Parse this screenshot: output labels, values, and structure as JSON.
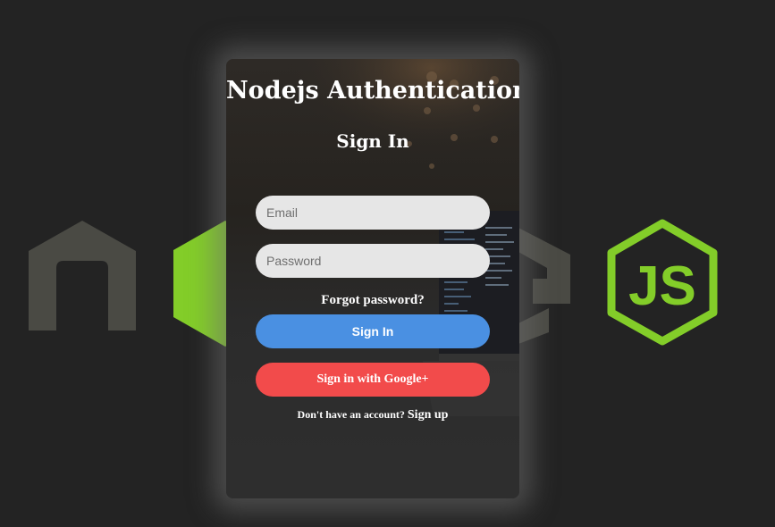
{
  "colors": {
    "page_background": "#232323",
    "node_green": "#83cd29",
    "node_grey": "#4a4a44",
    "field_background": "#e6e6e6",
    "signin_button": "#4a90e2",
    "google_button": "#f24b4b",
    "text": "#ffffff"
  },
  "background": {
    "logo_icon": "nodejs-logo-icon",
    "logo_text": "JS"
  },
  "card": {
    "app_title": "Nodejs Authentication",
    "form_title": "Sign In",
    "email": {
      "placeholder": "Email",
      "value": ""
    },
    "password": {
      "placeholder": "Password",
      "value": ""
    },
    "forgot_password": "Forgot password?",
    "signin_button": "Sign In",
    "google_button": "Sign in with Google+",
    "signup_prompt": "Don't have an account?",
    "signup_link": "Sign up"
  }
}
